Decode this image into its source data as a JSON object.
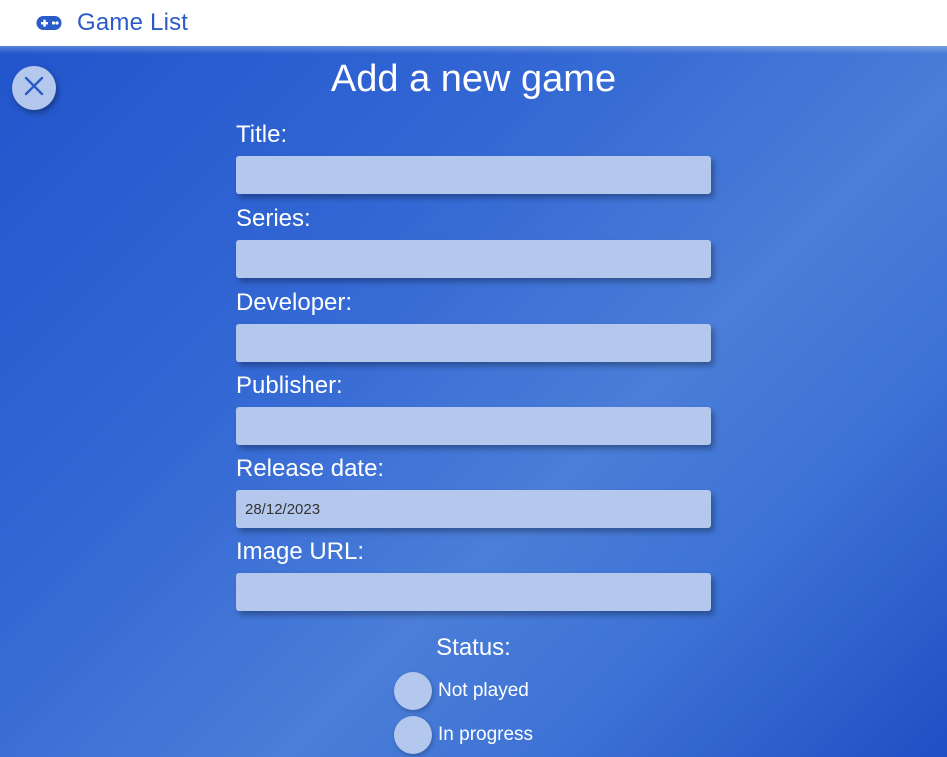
{
  "nav": {
    "brand_icon": "gamepad-icon",
    "brand_label": "Game List"
  },
  "form": {
    "close_icon": "close-icon",
    "title": "Add a new game",
    "fields": [
      {
        "label": "Title:",
        "value": "",
        "placeholder": ""
      },
      {
        "label": "Series:",
        "value": "",
        "placeholder": ""
      },
      {
        "label": "Developer:",
        "value": "",
        "placeholder": ""
      },
      {
        "label": "Publisher:",
        "value": "",
        "placeholder": ""
      },
      {
        "label": "Release date:",
        "value": "28/12/2023",
        "placeholder": ""
      },
      {
        "label": "Image URL:",
        "value": "",
        "placeholder": ""
      }
    ],
    "status": {
      "label": "Status:",
      "options": [
        "Not played",
        "In progress"
      ]
    }
  },
  "colors": {
    "accent": "#2a5bc7",
    "background_start": "#2255cc",
    "background_end": "#1f4fc4",
    "input_fill": "#b4c8ee"
  }
}
